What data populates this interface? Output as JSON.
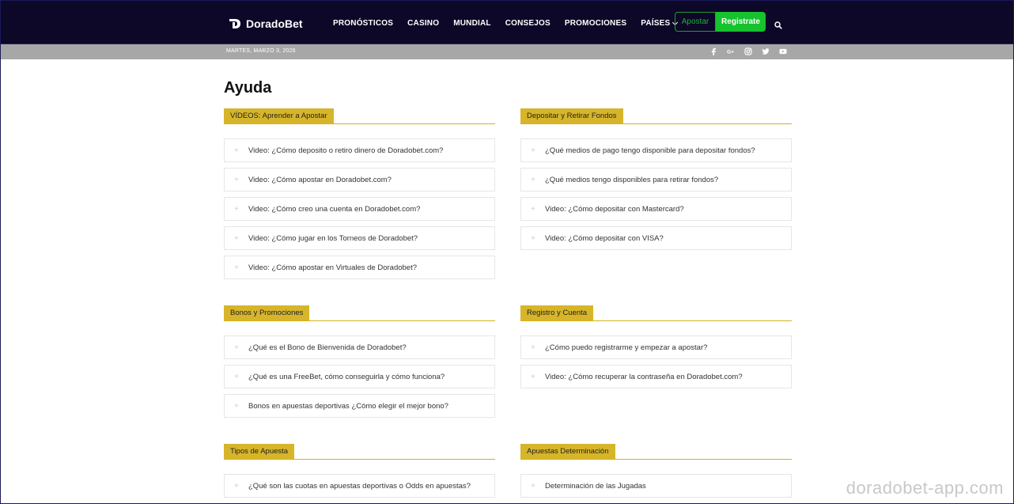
{
  "header": {
    "logo_text": "DoradoBet",
    "nav": [
      "PRONÓSTICOS",
      "CASINO",
      "MUNDIAL",
      "CONSEJOS",
      "PROMOCIONES",
      "PAÍSES"
    ],
    "apostar_label": "Apostar",
    "registrate_label": "Registrate",
    "accent_color": "#16c22e",
    "bg_color": "#0d0728"
  },
  "datebar": {
    "date": "MARTES, MARZO 3, 2026",
    "social_icons": [
      "facebook-icon",
      "google-plus-icon",
      "instagram-icon",
      "twitter-icon",
      "youtube-icon"
    ]
  },
  "page": {
    "title": "Ayuda",
    "section_color": "#d7b52a"
  },
  "sections": [
    {
      "title": "VÍDEOS: Aprender a Apostar",
      "items": [
        "Video: ¿Cómo deposito o retiro dinero de Doradobet.com?",
        "Video: ¿Cómo apostar en Doradobet.com?",
        "Video: ¿Cómo creo una cuenta en Doradobet.com?",
        "Video: ¿Cómo jugar en los Torneos de Doradobet?",
        "Video: ¿Cómo apostar en Virtuales de Doradobet?"
      ]
    },
    {
      "title": "Depositar y Retirar Fondos",
      "items": [
        "¿Qué medios de pago tengo disponible para depositar fondos?",
        "¿Qué medios tengo disponibles para retirar fondos?",
        "Video: ¿Cómo depositar con Mastercard?",
        "Video: ¿Cómo depositar con VISA?"
      ]
    },
    {
      "title": "Bonos y Promociones",
      "items": [
        "¿Qué es el Bono de Bienvenida de Doradobet?",
        "¿Qué es una FreeBet, cómo conseguirla y cómo funciona?",
        "Bonos en apuestas deportivas ¿Cómo elegir el mejor bono?"
      ]
    },
    {
      "title": "Registro y Cuenta",
      "items": [
        "¿Cómo puedo registrarme y empezar a apostar?",
        "Video: ¿Cómo recuperar la contraseña en Doradobet.com?"
      ]
    },
    {
      "title": "Tipos de Apuesta",
      "items": [
        "¿Qué son las cuotas en apuestas deportivas o Odds en apuestas?"
      ]
    },
    {
      "title": "Apuestas Determinación",
      "items": [
        "Determinación de las Jugadas"
      ]
    }
  ],
  "watermark": "doradobet-app.com"
}
